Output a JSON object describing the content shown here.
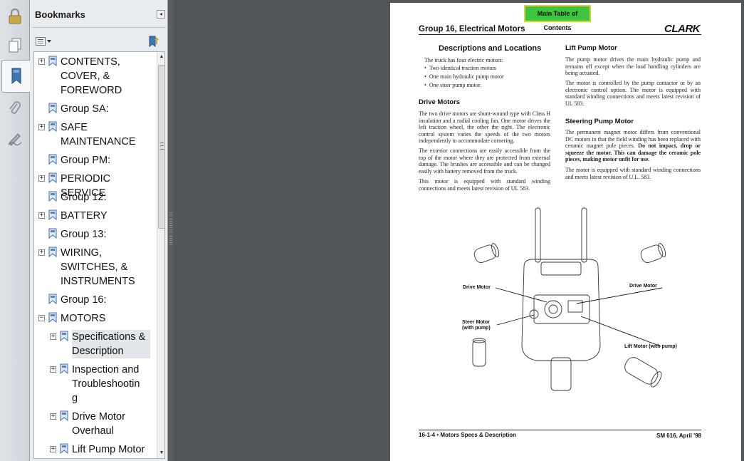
{
  "sidebar_rail": {
    "icons": [
      "lock-icon",
      "pages-icon",
      "bookmark-icon",
      "attachment-icon",
      "signature-icon"
    ]
  },
  "bookmarks_panel": {
    "title": "Bookmarks",
    "close_glyph": "◂",
    "items": [
      {
        "label": "CONTENTS, COVER, & FOREWORD",
        "lines": [
          "CONTENTS,",
          "COVER, &",
          "FOREWORD"
        ],
        "expander": "+"
      },
      {
        "label": "Group SA:",
        "lines": [
          "Group SA:"
        ],
        "expander": ""
      },
      {
        "label": "SAFE MAINTENANCE",
        "lines": [
          "SAFE",
          "MAINTENANCE"
        ],
        "expander": "+"
      },
      {
        "label": "Group PM:",
        "lines": [
          "Group PM:"
        ],
        "expander": ""
      },
      {
        "label": "PERIODIC SERVICE",
        "lines": [
          "PERIODIC SERVICE"
        ],
        "expander": "+"
      },
      {
        "label": "Group 12:",
        "lines": [
          "Group 12:"
        ],
        "expander": ""
      },
      {
        "label": "BATTERY",
        "lines": [
          "BATTERY"
        ],
        "expander": "+"
      },
      {
        "label": "Group 13:",
        "lines": [
          "Group 13:"
        ],
        "expander": ""
      },
      {
        "label": "WIRING, SWITCHES, & INSTRUMENTS",
        "lines": [
          "WIRING,",
          "SWITCHES, &",
          "INSTRUMENTS"
        ],
        "expander": "+"
      },
      {
        "label": "Group 16:",
        "lines": [
          "Group 16:"
        ],
        "expander": ""
      },
      {
        "label": "MOTORS",
        "lines": [
          "MOTORS"
        ],
        "expander": "−"
      },
      {
        "label": "Specifications & Description",
        "lines": [
          "Specifications &",
          "Description"
        ],
        "expander": "+",
        "selected": true
      },
      {
        "label": "Inspection and Troubleshooting",
        "lines": [
          "Inspection and",
          "Troubleshootin",
          "g"
        ],
        "expander": "+"
      },
      {
        "label": "Drive Motor Overhaul",
        "lines": [
          "Drive Motor",
          "Overhaul"
        ],
        "expander": "+"
      },
      {
        "label": "Lift Pump Motor",
        "lines": [
          "Lift Pump Motor"
        ],
        "expander": "+"
      }
    ]
  },
  "document": {
    "toc_button": "Main Table of Contents",
    "group_title": "Group 16, Electrical Motors",
    "logo": "CLARK",
    "left_col": {
      "heading": "Descriptions and Locations",
      "intro": "The truck has four electric motors:",
      "bullets": [
        "Two identical traction motors",
        "One main hydraulic pump motor",
        "One steer pump motor."
      ],
      "drive_heading": "Drive  Motors",
      "p1": "The two drive motors are shunt-wound type with Class H insulation and a radial cooling fan. One motor drives the left traction wheel, the other the right. The electronic control system varies the speeds of the two motors independently to accommodate cornering.",
      "p2": "The exterior connections are easily accessible from the top of the motor where they are protected from external damage.  The brushes are accessible and can be changed easily with battery removed from the truck.",
      "p3": "This motor is equipped with standard winding connections and meets latest revision of UL 583."
    },
    "right_col": {
      "lift_heading": "Lift Pump Motor",
      "p1": "The pump motor drives the main hydraulic pump and remains off except when the load handling cylinders are being actuated.",
      "p2": "The motor is controlled by the pump contactor or by an electronic control option. The motor is equipped with standard winding connections and meets latest revision of UL 583.",
      "steer_heading": "Steering Pump Motor",
      "p3a": "The permanent magnet motor differs from conventional DC motors in that the field winding has been replaced with ceramic magnet pole pieces.",
      "p3b": " Do not impact, drop or squeeze the motor. This can damage the ceramic pole pieces, making motor unfit for use.",
      "p4": "The motor is equipped with standard winding connections and meets latest revision of U.L. 583."
    },
    "figure": {
      "label_drive_left": "Drive Motor",
      "label_drive_right": "Drive Motor",
      "label_steer": "Steer Motor\n(with pump)",
      "label_lift": "Lift Motor (with pump)"
    },
    "footer_left": "16-1-4   •   Motors Specs & Description",
    "footer_right": "SM 616, April '98"
  }
}
